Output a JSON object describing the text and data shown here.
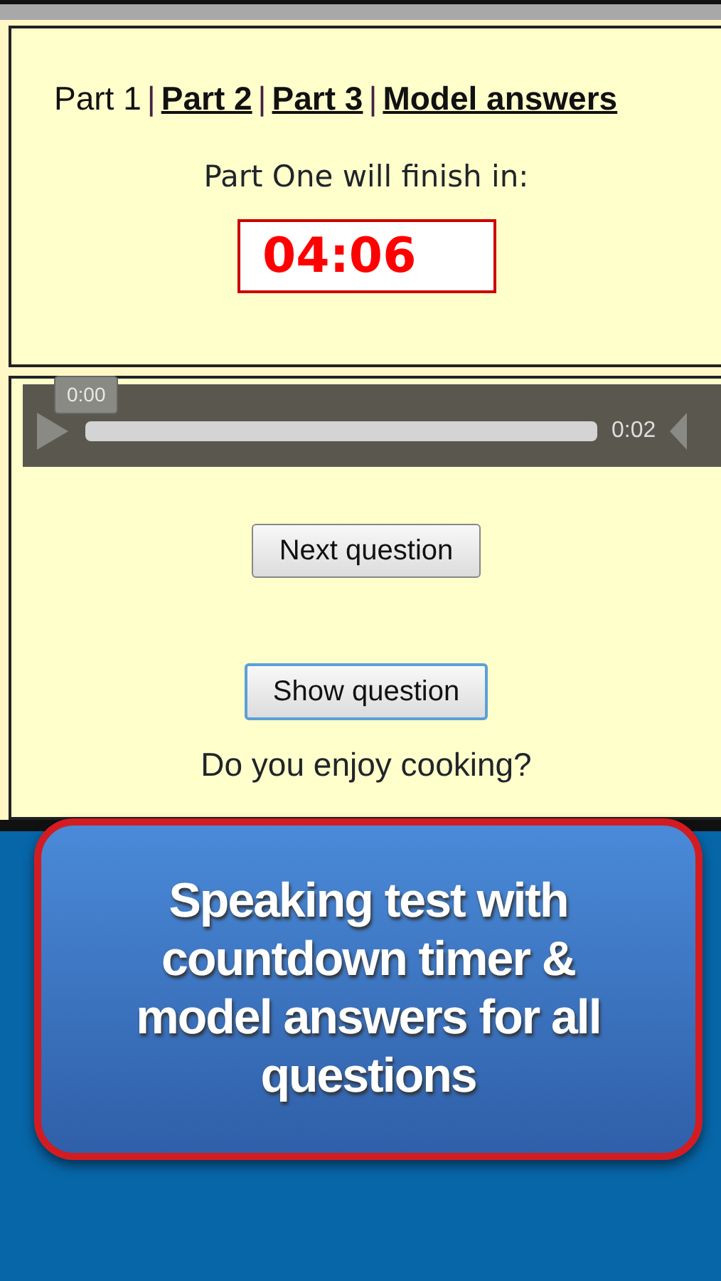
{
  "nav": [
    {
      "label": "Part 1",
      "selected": true
    },
    {
      "label": "Part 2",
      "selected": false
    },
    {
      "label": "Part 3",
      "selected": false
    },
    {
      "label": "Model answers",
      "selected": false
    }
  ],
  "separator": "|",
  "timer": {
    "caption": "Part One will finish in:",
    "value": "04:06"
  },
  "player": {
    "current_time": "0:00",
    "duration": "0:02",
    "level": 0
  },
  "buttons": [
    {
      "label": "Next question",
      "focused": false
    },
    {
      "label": "Show question",
      "focused": true
    }
  ],
  "question": "Do you enjoy cooking?",
  "callout": "Speaking test with countdown timer & model answers for all questions"
}
